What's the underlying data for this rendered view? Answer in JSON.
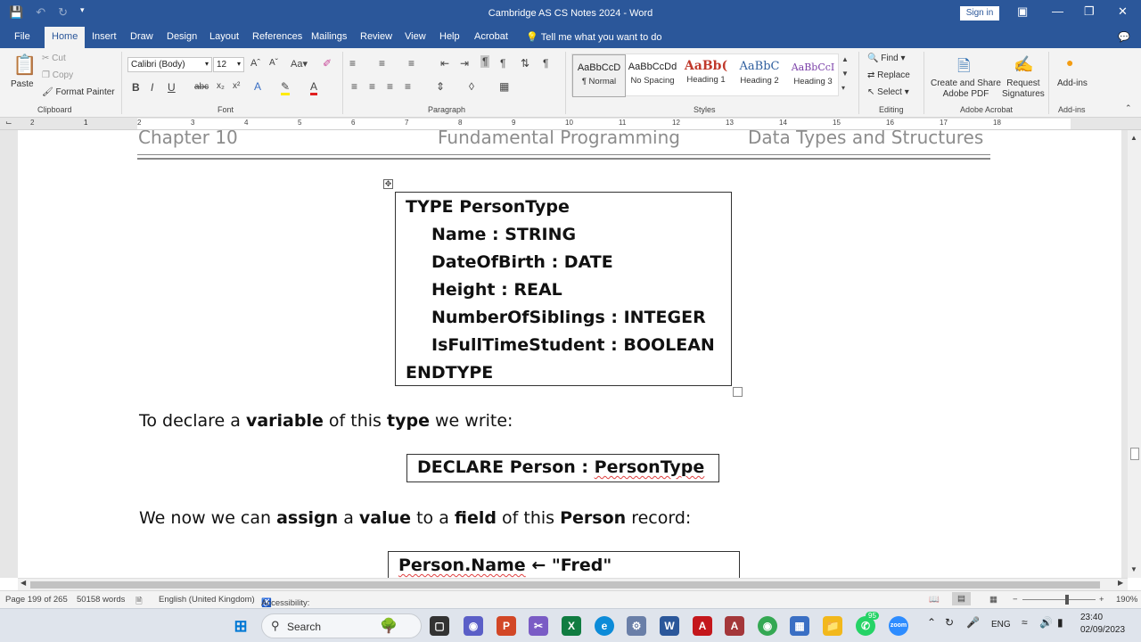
{
  "window": {
    "title": "Cambridge AS CS Notes 2024  -  Word",
    "sign_in": "Sign in"
  },
  "tabs": [
    "File",
    "Home",
    "Insert",
    "Draw",
    "Design",
    "Layout",
    "References",
    "Mailings",
    "Review",
    "View",
    "Help",
    "Acrobat"
  ],
  "active_tab": "Home",
  "tell_me": "Tell me what you want to do",
  "ribbon": {
    "clipboard": {
      "paste": "Paste",
      "cut": "Cut",
      "copy": "Copy",
      "format_painter": "Format Painter",
      "label": "Clipboard"
    },
    "font": {
      "name": "Calibri (Body)",
      "size": "12",
      "label": "Font"
    },
    "paragraph": {
      "label": "Paragraph"
    },
    "styles": {
      "label": "Styles",
      "items": [
        {
          "preview": "AaBbCcD",
          "name": "¶ Normal"
        },
        {
          "preview": "AaBbCcDd",
          "name": "No Spacing"
        },
        {
          "preview": "AaBb(",
          "name": "Heading 1"
        },
        {
          "preview": "AaBbC",
          "name": "Heading 2"
        },
        {
          "preview": "AaBbCcI",
          "name": "Heading 3"
        }
      ]
    },
    "editing": {
      "find": "Find",
      "replace": "Replace",
      "select": "Select",
      "label": "Editing"
    },
    "acrobat": {
      "create_share": "Create and Share\nAdobe PDF",
      "request_sig": "Request\nSignatures",
      "label": "Adobe Acrobat"
    },
    "addins": {
      "btn": "Add-ins",
      "label": "Add-ins"
    }
  },
  "ruler": {
    "numbers": [
      "2",
      "1",
      "1",
      "2",
      "3",
      "4",
      "5",
      "6",
      "7",
      "8",
      "9",
      "10",
      "11",
      "12",
      "13",
      "14",
      "15",
      "16",
      "17",
      "18"
    ]
  },
  "document": {
    "header": {
      "left": "Chapter 10",
      "center": "Fundamental Programming",
      "right": "Data Types and Structures"
    },
    "type_block": [
      "TYPE PersonType",
      "Name : STRING",
      "DateOfBirth : DATE",
      "Height : REAL",
      "NumberOfSiblings : INTEGER",
      "IsFullTimeStudent : BOOLEAN",
      "ENDTYPE"
    ],
    "para1": {
      "a": "To declare a ",
      "b": "variable",
      "c": " of this ",
      "d": "type",
      "e": " we write:"
    },
    "declare": {
      "a": "DECLARE Person : ",
      "b": "PersonType"
    },
    "para2": {
      "a": "We now we can ",
      "b": "assign",
      "c": " a ",
      "d": "value",
      "e": " to a ",
      "f": "field",
      "g": " of this ",
      "h": "Person",
      "i": " record:"
    },
    "assign": {
      "a": "Person.Name",
      "b": " ← \"Fred\""
    }
  },
  "status": {
    "page": "Page 199 of 265",
    "words": "50158 words",
    "language": "English (United Kingdom)",
    "accessibility": "Accessibility: Investigate",
    "zoom": "190%"
  },
  "taskbar": {
    "search": "Search",
    "badge": "95",
    "lang": "ENG",
    "time": "23:40",
    "date": "02/09/2023"
  },
  "colors": {
    "word_blue": "#2b579a",
    "spell_red": "#e04040"
  }
}
